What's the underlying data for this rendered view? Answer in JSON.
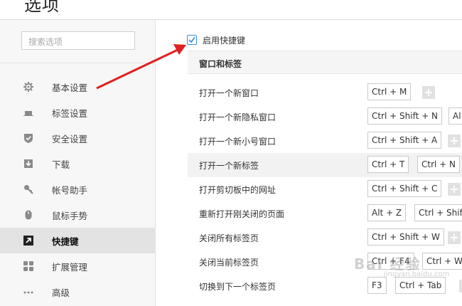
{
  "window": {
    "title": "选项"
  },
  "sidebar": {
    "search_placeholder": "搜索选项",
    "items": [
      {
        "label": "基本设置",
        "icon": "gear-icon"
      },
      {
        "label": "标签设置",
        "icon": "tab-icon"
      },
      {
        "label": "安全设置",
        "icon": "shield-check-icon"
      },
      {
        "label": "下载",
        "icon": "download-icon"
      },
      {
        "label": "帐号助手",
        "icon": "key-icon"
      },
      {
        "label": "鼠标手势",
        "icon": "mouse-icon"
      },
      {
        "label": "快捷键",
        "icon": "shortcut-arrow-icon",
        "active": true
      },
      {
        "label": "扩展管理",
        "icon": "extensions-grid-icon"
      },
      {
        "label": "高级",
        "icon": "more-dots-icon"
      }
    ]
  },
  "main": {
    "enable_shortcuts_label": "启用快捷键",
    "enable_shortcuts_checked": true,
    "section_title": "窗口和标签",
    "rows": [
      {
        "label": "打开一个新窗口",
        "keys": [
          "Ctrl + M"
        ]
      },
      {
        "label": "打开一个新隐私窗口",
        "keys": [
          "Ctrl + Shift + N",
          "Al"
        ]
      },
      {
        "label": "打开一个新小号窗口",
        "keys": [
          "Ctrl + Shift + A"
        ]
      },
      {
        "label": "打开一个新标签",
        "keys": [
          "Ctrl + T",
          "Ctrl + N"
        ],
        "highlighted": true
      },
      {
        "label": "打开剪切板中的网址",
        "keys": [
          "Ctrl + Shift + C"
        ]
      },
      {
        "label": "重新打开刚关闭的页面",
        "keys": [
          "Alt + Z",
          "Ctrl + Shift"
        ]
      },
      {
        "label": "关闭所有标签页",
        "keys": [
          "Ctrl + Shift + W"
        ]
      },
      {
        "label": "关闭当前标签页",
        "keys": [
          "Ctrl + F4",
          "Ctrl + W"
        ]
      },
      {
        "label": "切换到下一个标签页",
        "keys": [
          "F3",
          "Ctrl + Tab"
        ]
      }
    ]
  },
  "watermark": {
    "text": "Bai 经验",
    "sub": "jingyan.baidu.com"
  },
  "colors": {
    "accent": "#3a8ee6",
    "arrow": "#e02020",
    "active_bg": "#e3e3e3"
  }
}
